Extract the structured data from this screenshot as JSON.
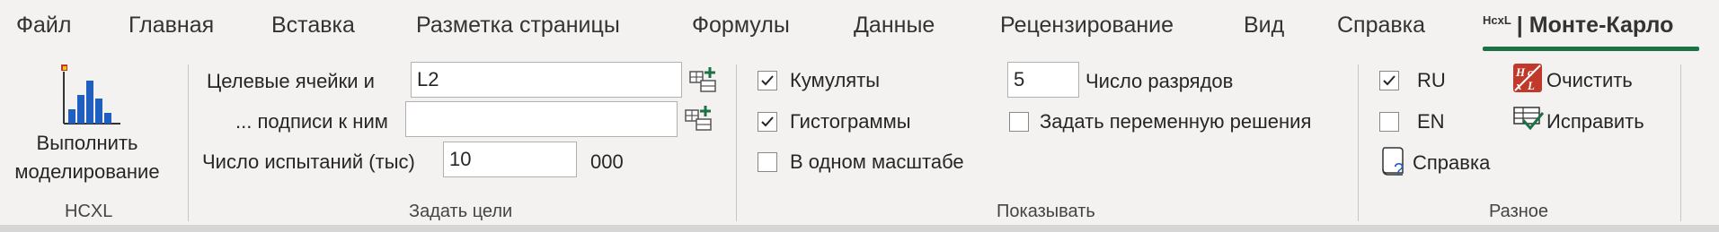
{
  "tabs": {
    "file": "Файл",
    "home": "Главная",
    "insert": "Вставка",
    "layout": "Разметка страницы",
    "formulas": "Формулы",
    "data": "Данные",
    "review": "Рецензирование",
    "view": "Вид",
    "help": "Справка",
    "montecarlo_prefix": "HcxL",
    "montecarlo": "| Монте-Карло"
  },
  "hcxl_group": {
    "run_line1": "Выполнить",
    "run_line2": "моделирование",
    "label": "HCXL"
  },
  "goals_group": {
    "target_cells_label": "Целевые ячейки и",
    "target_cells_value": "L2",
    "captions_label": "... подписи к ним",
    "captions_value": "",
    "trials_label": "Число испытаний (тыс)",
    "trials_value": "10",
    "trials_suffix": "000",
    "label": "Задать цели"
  },
  "show_group": {
    "cumulates_label": "Кумуляты",
    "cumulates_checked": true,
    "histograms_label": "Гистограммы",
    "histograms_checked": true,
    "same_scale_label": "В одном масштабе",
    "same_scale_checked": false,
    "digits_value": "5",
    "digits_label": "Число разрядов",
    "decision_var_label": "Задать переменную решения",
    "decision_var_checked": false,
    "label": "Показывать"
  },
  "misc_group": {
    "ru_label": "RU",
    "ru_checked": true,
    "en_label": "EN",
    "en_checked": false,
    "clear_label": "Очистить",
    "fix_label": "Исправить",
    "help_label": "Справка",
    "label": "Разное"
  },
  "colors": {
    "accent_green": "#1e7145",
    "chart_blue": "#1f5fbf",
    "clear_red": "#c0392b"
  }
}
